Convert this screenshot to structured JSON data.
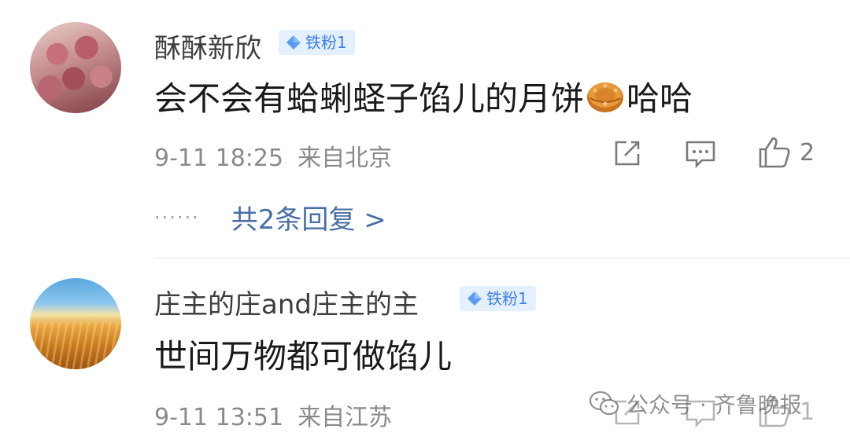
{
  "comments": [
    {
      "username": "酥酥新欣",
      "badge": "铁粉1",
      "text_before": "会不会有蛤蜊蛏子馅儿的月饼",
      "emoji": "mooncake-emoji",
      "text_after": "哈哈",
      "date": "9-11 18:25",
      "location": "来自北京",
      "like_count": "2",
      "replies_dots": "······",
      "replies_label": "共2条回复 >"
    },
    {
      "username": "庄主的庄and庄主的主",
      "badge": "铁粉1",
      "text": "世间万物都可做馅儿",
      "date": "9-11 13:51",
      "location": "来自江苏",
      "like_count": "1"
    }
  ],
  "watermark": "公众号 · 齐鲁晚报",
  "colors": {
    "badge_bg": "#e5f0ff",
    "badge_text": "#3d7ee6",
    "link": "#4a6fa5"
  },
  "icons": [
    "share-edit-icon",
    "comment-icon",
    "thumbs-up-icon",
    "diamond-icon",
    "wechat-icon"
  ]
}
